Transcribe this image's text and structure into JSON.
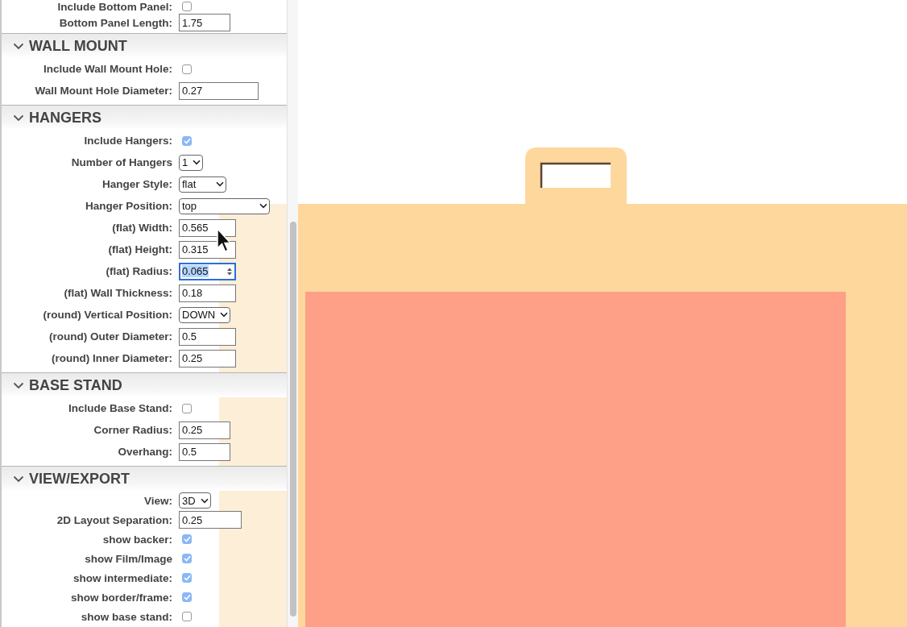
{
  "settings_panel": {
    "sections": [
      {
        "rows": [
          {
            "kind": "checkbox",
            "label": "Include Bottom Panel:",
            "checked": false
          },
          {
            "kind": "text",
            "label": "Bottom Panel Length:",
            "value": "1.75",
            "focused": false
          }
        ]
      },
      {
        "title": "WALL MOUNT",
        "expanded": true,
        "rows": [
          {
            "kind": "checkbox",
            "label": "Include Wall Mount Hole:",
            "checked": false
          },
          {
            "kind": "text",
            "label": "Wall Mount Hole Diameter:",
            "value": "0.27",
            "focused": false
          }
        ]
      },
      {
        "title": "HANGERS",
        "expanded": true,
        "rows": [
          {
            "kind": "checkbox",
            "label": "Include Hangers:",
            "checked": true
          },
          {
            "kind": "select",
            "label": "Number of Hangers",
            "value": "1"
          },
          {
            "kind": "select",
            "label": "Hanger Style:",
            "value": "flat"
          },
          {
            "kind": "select",
            "label": "Hanger Position:",
            "value": "top"
          },
          {
            "kind": "text",
            "label": "(flat) Width:",
            "value": "0.565",
            "focused": false
          },
          {
            "kind": "text",
            "label": "(flat) Height:",
            "value": "0.315",
            "focused": false
          },
          {
            "kind": "number",
            "label": "(flat) Radius:",
            "value": "0.065",
            "focused": true
          },
          {
            "kind": "text",
            "label": "(flat) Wall Thickness:",
            "value": "0.18",
            "focused": false
          },
          {
            "kind": "select",
            "label": "(round) Vertical Position:",
            "value": "DOWN"
          },
          {
            "kind": "text",
            "label": "(round) Outer Diameter:",
            "value": "0.5",
            "focused": false
          },
          {
            "kind": "text",
            "label": "(round) Inner Diameter:",
            "value": "0.25",
            "focused": false
          }
        ]
      },
      {
        "title": "BASE STAND",
        "expanded": true,
        "rows": [
          {
            "kind": "checkbox",
            "label": "Include Base Stand:",
            "checked": false
          },
          {
            "kind": "text",
            "label": "Corner Radius:",
            "value": "0.25",
            "focused": false
          },
          {
            "kind": "text",
            "label": "Overhang:",
            "value": "0.5",
            "focused": false
          }
        ]
      },
      {
        "title": "VIEW/EXPORT",
        "expanded": true,
        "rows": [
          {
            "kind": "select",
            "label": "View:",
            "value": "3D"
          },
          {
            "kind": "text",
            "label": "2D Layout Separation:",
            "value": "0.25",
            "focused": false
          },
          {
            "kind": "checkbox",
            "label": "show backer:",
            "checked": true
          },
          {
            "kind": "checkbox",
            "label": "show Film/Image",
            "checked": true
          },
          {
            "kind": "checkbox",
            "label": "show intermediate:",
            "checked": true
          },
          {
            "kind": "checkbox",
            "label": "show border/frame:",
            "checked": true
          },
          {
            "kind": "checkbox",
            "label": "show base stand:",
            "checked": false
          }
        ]
      }
    ]
  }
}
